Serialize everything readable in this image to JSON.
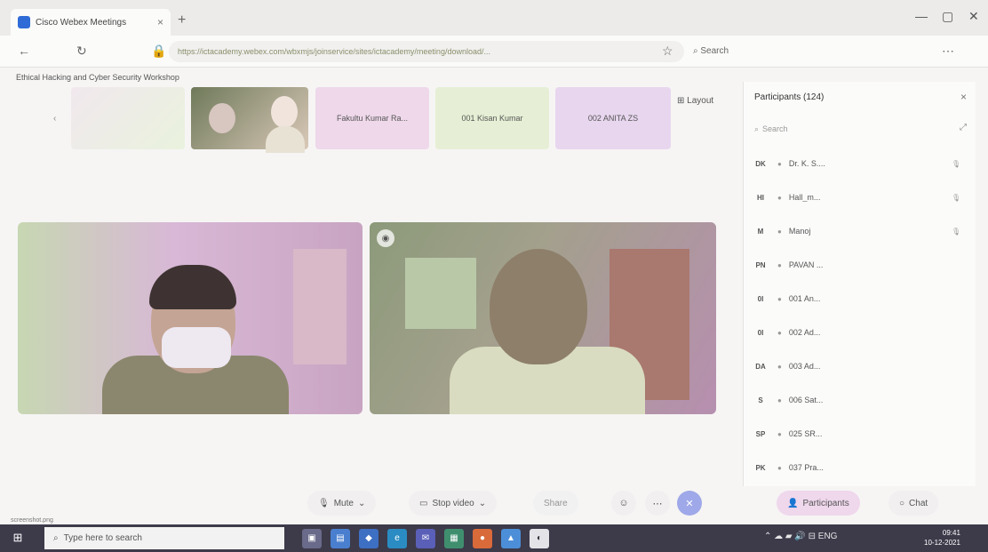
{
  "browser": {
    "tab_title": "Cisco Webex Meetings",
    "new_tab_icon": "plus",
    "url": "https://ictacademy.webex.com/wbxmjs/joinservice/sites/ictacademy/meeting/download/...",
    "search_label": "Search",
    "window_controls": [
      "—",
      "▢",
      "✕"
    ]
  },
  "meeting": {
    "title": "Ethical Hacking and Cyber Security Workshop",
    "timer": "Ethical Hacking and Cyber Security Workshop"
  },
  "strip": {
    "thumbs": [
      {
        "label": ""
      },
      {
        "label": ""
      },
      {
        "label": "Fakultu Kumar Ra..."
      },
      {
        "label": "001 Kisan Kumar"
      },
      {
        "label": "002 ANITA ZS"
      }
    ],
    "next_label": "Layout"
  },
  "panel": {
    "title": "Participants (124)",
    "search_placeholder": "Search",
    "participants": [
      {
        "initials": "DK",
        "name": "Dr. K. S...."
      },
      {
        "initials": "HI",
        "name": "Hall_m..."
      },
      {
        "initials": "M",
        "name": "Manoj"
      },
      {
        "initials": "PN",
        "name": "PAVAN ..."
      },
      {
        "initials": "0I",
        "name": "001 An..."
      },
      {
        "initials": "0I",
        "name": "002 Ad..."
      },
      {
        "initials": "DA",
        "name": "003 Ad..."
      },
      {
        "initials": "S",
        "name": "006 Sat..."
      },
      {
        "initials": "SP",
        "name": "025 SR..."
      },
      {
        "initials": "PK",
        "name": "037 Pra..."
      }
    ]
  },
  "controls": {
    "mute_label": "Mute",
    "video_label": "Stop video",
    "share_label": "Share",
    "participants_label": "Participants",
    "chat_label": "Chat"
  },
  "taskbar": {
    "search_placeholder": "Type here to search",
    "time": "09:41",
    "date": "10-12-2021"
  },
  "status_left": "screenshot.png"
}
